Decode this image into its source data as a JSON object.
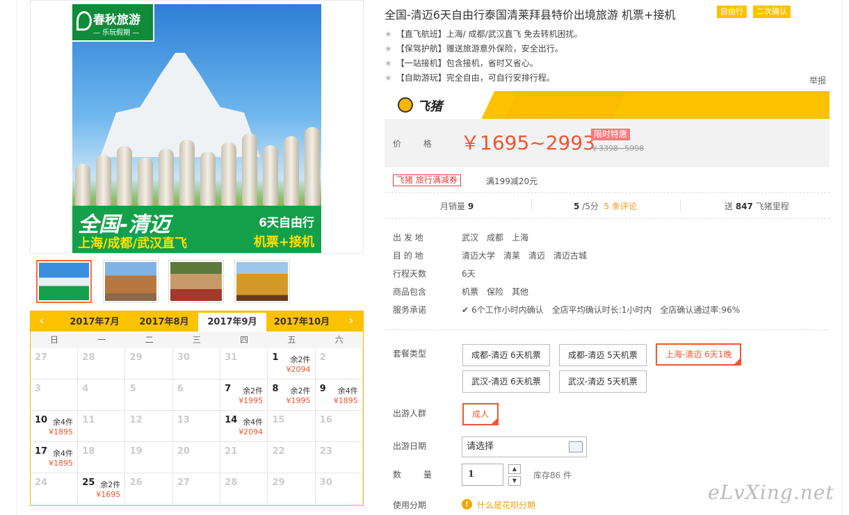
{
  "product": {
    "title": "全国-清迈6天自由行泰国清莱拜县特价出境旅游 机票+接机",
    "tags": [
      "自由行",
      "二次确认"
    ],
    "features": [
      "【直飞航班】上海/ 成都/武汉直飞 免去转机困扰。",
      "【保驾护航】赠送旅游意外保险，安全出行。",
      "【一站接机】包含接机，省时又省心。",
      "【自助游玩】完全自由，可自行安排行程。"
    ],
    "report": "举报"
  },
  "image": {
    "logo_name": "春秋旅游",
    "logo_slogan": "— 乐玩假期 —",
    "banner_title": "全国-清迈",
    "banner_sub": "上海/成都/武汉直飞",
    "banner_days": "6天自由行",
    "banner_incl": "机票+接机"
  },
  "platform": {
    "name": "飞猪"
  },
  "price": {
    "label": "价 格",
    "range": "￥1695~2993",
    "sale_tag": "限时特惠",
    "original": "￥3398~5998"
  },
  "coupon": {
    "badge": "飞猪 旅行满减券",
    "text": "满199减20元"
  },
  "stats": {
    "monthly_label": "月销量",
    "monthly_value": "9",
    "rating": "5",
    "rating_suffix": "/5分",
    "reviews": "5 条评论",
    "miles_prefix": "送",
    "miles": "847",
    "miles_suffix": "飞猪里程"
  },
  "details": [
    {
      "label": "出 发 地",
      "values": [
        "武汉",
        "成都",
        "上海"
      ]
    },
    {
      "label": "目 的 地",
      "values": [
        "清迈大学",
        "清莱",
        "清迈",
        "清迈古城"
      ]
    },
    {
      "label": "行程天数",
      "values": [
        "6天"
      ]
    },
    {
      "label": "商品包含",
      "values": [
        "机票",
        "保险",
        "其他"
      ]
    },
    {
      "label": "服务承诺",
      "values": [
        "6个工作小时内确认",
        "全店平均确认时长:1小时内",
        "全店确认通过率:96%"
      ]
    }
  ],
  "options": {
    "package_label": "套餐类型",
    "packages": [
      "成都-清迈 6天机票",
      "成都-清迈 5天机票",
      "上海-清迈 6天1晚",
      "武汉-清迈 6天机票",
      "武汉-清迈 5天机票"
    ],
    "selected_package": "上海-清迈 6天1晚",
    "crowd_label": "出游人群",
    "crowd": "成人",
    "date_label": "出游日期",
    "date_placeholder": "请选择",
    "qty_label": "数 量",
    "qty": "1",
    "stock": "库存86 件",
    "installment_label": "使用分期",
    "installment_link": "什么是花呗分期"
  },
  "calendar": {
    "months": [
      "2017年7月",
      "2017年8月",
      "2017年9月",
      "2017年10月"
    ],
    "active_month": "2017年9月",
    "weekdays": [
      "日",
      "一",
      "二",
      "三",
      "四",
      "五",
      "六"
    ],
    "cells": [
      {
        "d": "27"
      },
      {
        "d": "28"
      },
      {
        "d": "29"
      },
      {
        "d": "30"
      },
      {
        "d": "31"
      },
      {
        "d": "1",
        "left": "余2件",
        "price": "¥2094"
      },
      {
        "d": "2"
      },
      {
        "d": "3"
      },
      {
        "d": "4"
      },
      {
        "d": "5"
      },
      {
        "d": "6"
      },
      {
        "d": "7",
        "left": "余2件",
        "price": "¥1995"
      },
      {
        "d": "8",
        "left": "余2件",
        "price": "¥1995"
      },
      {
        "d": "9",
        "left": "余4件",
        "price": "¥1895"
      },
      {
        "d": "10",
        "left": "余4件",
        "price": "¥1895"
      },
      {
        "d": "11"
      },
      {
        "d": "12"
      },
      {
        "d": "13"
      },
      {
        "d": "14",
        "left": "余4件",
        "price": "¥2094"
      },
      {
        "d": "15"
      },
      {
        "d": "16"
      },
      {
        "d": "17",
        "left": "余4件",
        "price": "¥1895"
      },
      {
        "d": "18"
      },
      {
        "d": "19"
      },
      {
        "d": "20"
      },
      {
        "d": "21"
      },
      {
        "d": "22"
      },
      {
        "d": "23"
      },
      {
        "d": "24"
      },
      {
        "d": "25",
        "left": "余2件",
        "price": "¥1695"
      },
      {
        "d": "26"
      },
      {
        "d": "27"
      },
      {
        "d": "28"
      },
      {
        "d": "29"
      },
      {
        "d": "30"
      }
    ]
  },
  "watermark": "eLvXing.net",
  "colors": {
    "accent": "#f0552f",
    "brand_yellow": "#fcc202",
    "green": "#14a04a"
  }
}
